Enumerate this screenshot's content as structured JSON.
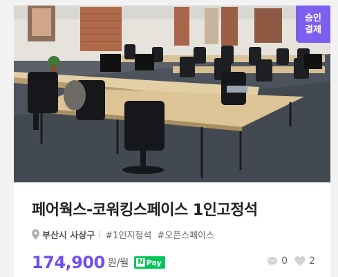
{
  "listing": {
    "badge_line1": "승인",
    "badge_line2": "결제",
    "title": "페어웍스-코워킹스페이스 1인고정석",
    "location": "부산시 사상구",
    "tags": [
      "#1인지정석",
      "#오픈스페이스"
    ],
    "price": "174,900",
    "price_unit": "원/월",
    "pay_badge": "Pay",
    "pay_badge_prefix": "N",
    "comment_count": "0",
    "like_count": "2"
  },
  "colors": {
    "accent": "#6e4ff0",
    "badge": "#7d5ff0",
    "naver_pay": "#03c75a"
  },
  "icons": {
    "location": "map-pin-icon",
    "comments": "speech-bubble-icon",
    "likes": "heart-icon"
  }
}
